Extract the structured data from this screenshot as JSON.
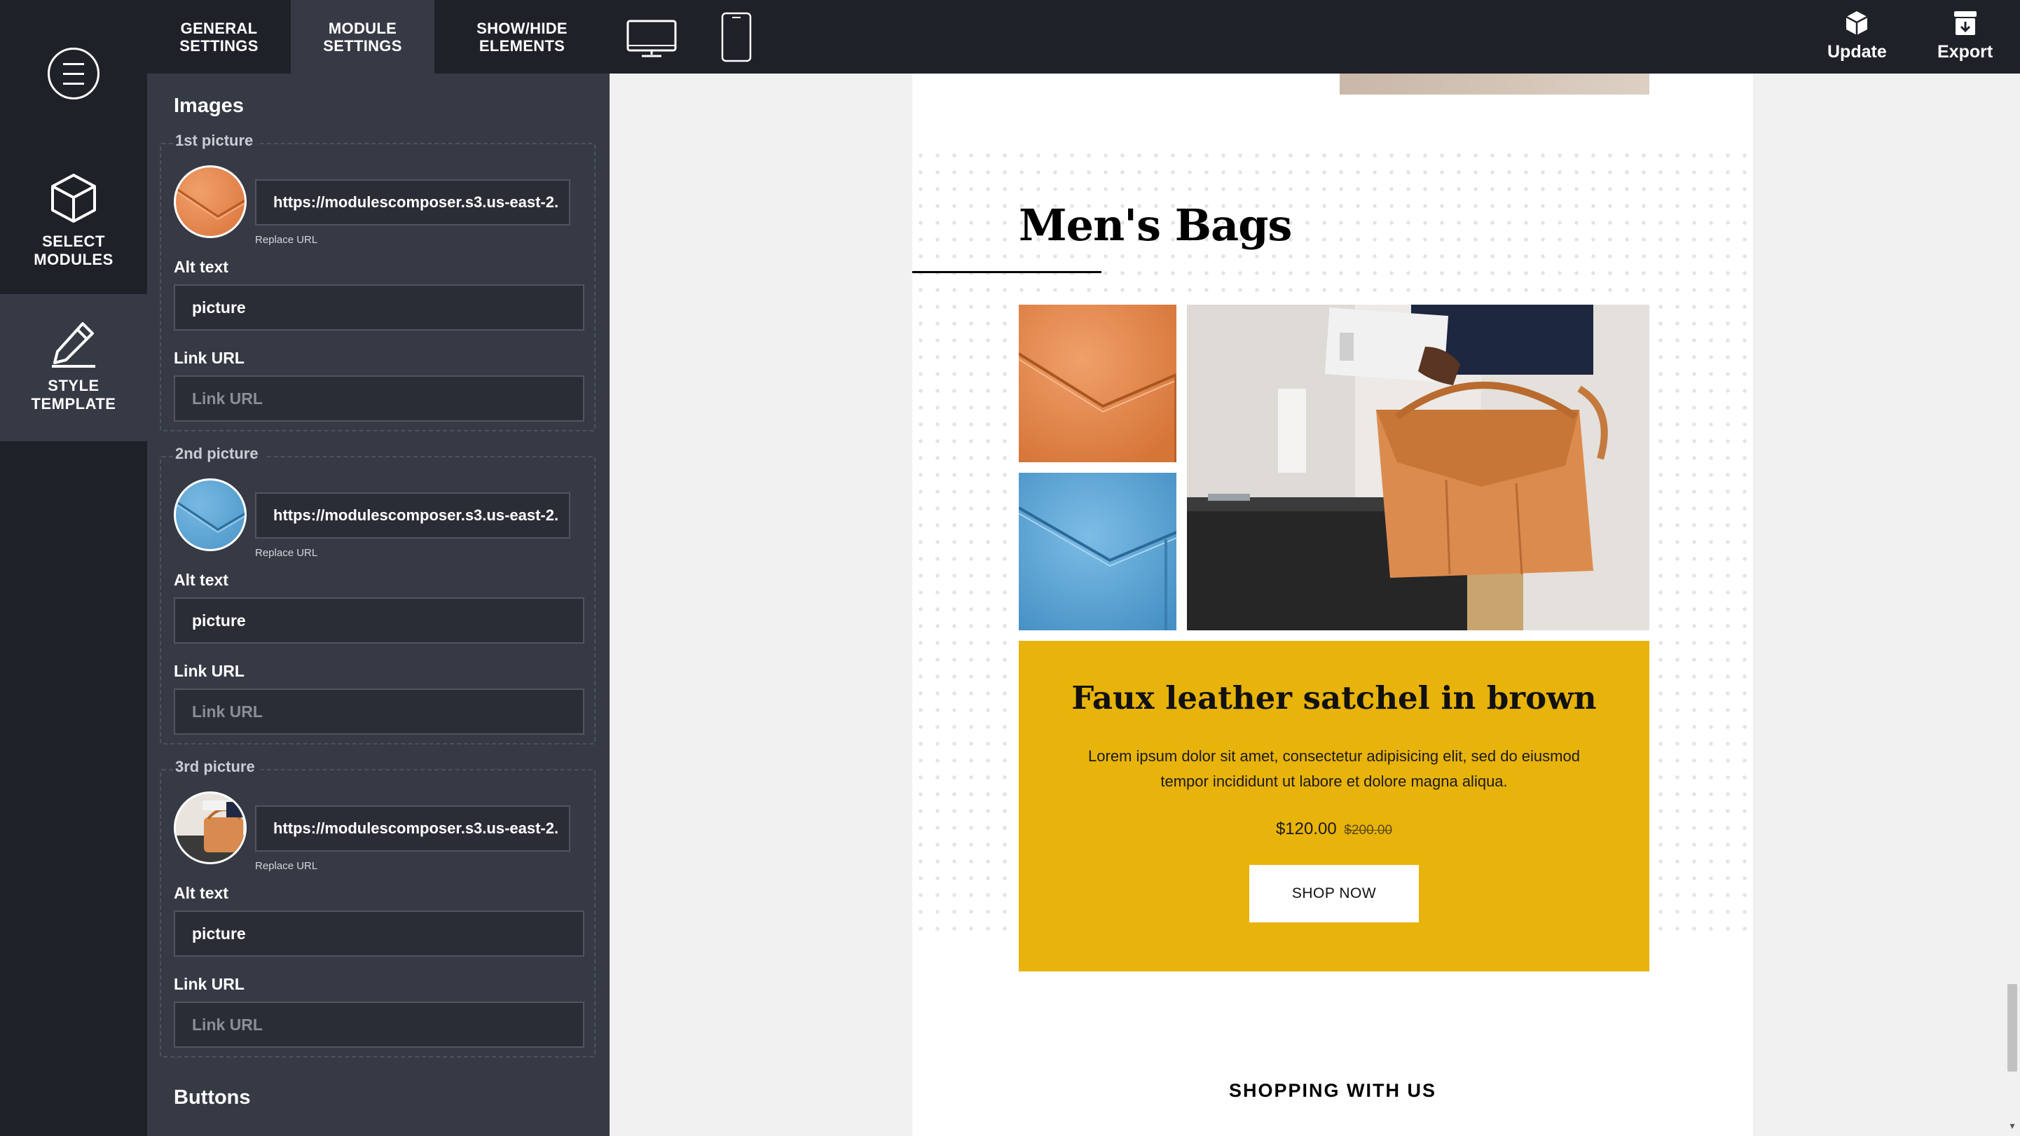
{
  "rail": {
    "items": [
      {
        "label_line1": "SELECT",
        "label_line2": "MODULES",
        "icon": "cube-icon"
      },
      {
        "label_line1": "STYLE",
        "label_line2": "TEMPLATE",
        "icon": "pencil-icon"
      }
    ]
  },
  "topbar": {
    "tabs": [
      {
        "line1": "GENERAL",
        "line2": "SETTINGS"
      },
      {
        "line1": "MODULE",
        "line2": "SETTINGS"
      },
      {
        "line1": "SHOW/HIDE",
        "line2": "ELEMENTS"
      }
    ],
    "update_label": "Update",
    "export_label": "Export"
  },
  "panel": {
    "section_title": "Images",
    "pictures": [
      {
        "title": "1st picture",
        "url": "https://modulescomposer.s3.us-east-2.",
        "replace": "Replace URL",
        "alt_label": "Alt text",
        "alt_value": "picture",
        "link_label": "Link URL",
        "link_placeholder": "Link URL"
      },
      {
        "title": "2nd picture",
        "url": "https://modulescomposer.s3.us-east-2.",
        "replace": "Replace URL",
        "alt_label": "Alt text",
        "alt_value": "picture",
        "link_label": "Link URL",
        "link_placeholder": "Link URL"
      },
      {
        "title": "3rd picture",
        "url": "https://modulescomposer.s3.us-east-2.",
        "replace": "Replace URL",
        "alt_label": "Alt text",
        "alt_value": "picture",
        "link_label": "Link URL",
        "link_placeholder": "Link URL"
      }
    ],
    "buttons_title": "Buttons"
  },
  "email": {
    "heading": "Men's Bags",
    "product_name": "Faux leather satchel in brown",
    "product_description": "Lorem ipsum dolor sit amet, consectetur adipisicing elit, sed do eiusmod tempor incididunt ut labore et dolore magna aliqua.",
    "price": "$120.00",
    "old_price": "$200.00",
    "button_label": "SHOP NOW",
    "footer_heading": "SHOPPING WITH US"
  },
  "colors": {
    "dark_bar": "#1f2129",
    "panel": "#363a45",
    "accent_yellow": "#e8b30a",
    "orange_leather": "#e8874a",
    "blue_leather": "#5aa5d6"
  }
}
